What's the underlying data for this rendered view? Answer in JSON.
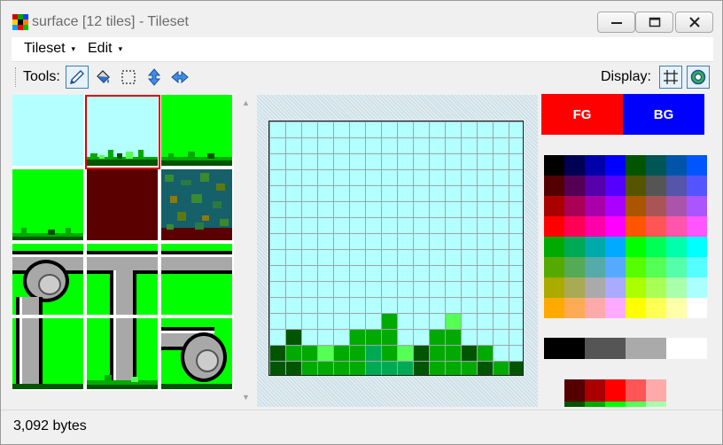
{
  "window": {
    "title": "surface [12 tiles] - Tileset",
    "controls": [
      "minimize",
      "maximize",
      "close"
    ]
  },
  "menubar": {
    "items": [
      {
        "label": "Tileset",
        "arrow": "▾"
      },
      {
        "label": "Edit",
        "arrow": "▾"
      }
    ]
  },
  "toolbar": {
    "tools_label": "Tools:",
    "tools": [
      "pencil-icon",
      "fill-bucket-icon",
      "select-rect-icon",
      "flip-vertical-icon",
      "flip-horizontal-icon"
    ],
    "active_tool": "pencil-icon",
    "display_label": "Display:",
    "display_buttons": [
      "grid-toggle-icon",
      "overlay-toggle-icon"
    ]
  },
  "tiles": {
    "count": 12,
    "selected_index": 1
  },
  "colors": {
    "fg": "#ff0000",
    "bg": "#0000ff",
    "sky": "#b4ffff",
    "grass": "#00ff00",
    "dirt": "#5a0000",
    "selection": "#e20000"
  },
  "palette": {
    "fg_label": "FG",
    "bg_label": "BG",
    "main": [
      "#000000",
      "#000055",
      "#0000aa",
      "#0000ff",
      "#005500",
      "#005555",
      "#0055aa",
      "#0055ff",
      "#550000",
      "#550055",
      "#5500aa",
      "#5500ff",
      "#555500",
      "#555555",
      "#5555aa",
      "#5555ff",
      "#aa0000",
      "#aa0055",
      "#aa00aa",
      "#aa00ff",
      "#aa5500",
      "#aa5555",
      "#aa55aa",
      "#aa55ff",
      "#ff0000",
      "#ff0055",
      "#ff00aa",
      "#ff00ff",
      "#ff5500",
      "#ff5555",
      "#ff55aa",
      "#ff55ff",
      "#00aa00",
      "#00aa55",
      "#00aaaa",
      "#00aaff",
      "#00ff00",
      "#00ff55",
      "#00ffaa",
      "#00ffff",
      "#55aa00",
      "#55aa55",
      "#55aaaa",
      "#55aaff",
      "#55ff00",
      "#55ff55",
      "#55ffaa",
      "#55ffff",
      "#aaaa00",
      "#aaaa55",
      "#aaaaaa",
      "#aaaaff",
      "#aaff00",
      "#aaff55",
      "#aaffaa",
      "#aaffff",
      "#ffaa00",
      "#ffaa55",
      "#ffaaaa",
      "#ffaaff",
      "#ffff00",
      "#ffff55",
      "#ffffaa",
      "#ffffff"
    ],
    "grays": [
      "#000000",
      "#555555",
      "#aaaaaa",
      "#ffffff"
    ],
    "reds": [
      "#550000",
      "#aa0000",
      "#ff0000",
      "#ff5555",
      "#ffaaaa"
    ],
    "greens": [
      "#005500",
      "#00aa00",
      "#00ff00",
      "#55ff55",
      "#aaffaa"
    ]
  },
  "status": {
    "text": "3,092 bytes"
  }
}
